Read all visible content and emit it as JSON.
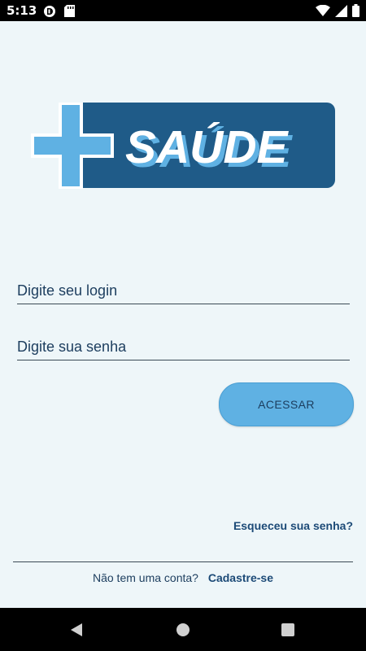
{
  "status_bar": {
    "time": "5:13",
    "icons": [
      "notification-icon",
      "sd-card-icon",
      "wifi-icon",
      "signal-icon",
      "battery-icon"
    ]
  },
  "logo": {
    "text": "SAÚDE",
    "colors": {
      "plus": "#5fb1e3",
      "banner": "#1f5b88",
      "text": "#ffffff"
    }
  },
  "form": {
    "login_placeholder": "Digite seu login",
    "password_placeholder": "Digite sua senha",
    "access_label": "ACESSAR"
  },
  "links": {
    "forgot_password": "Esqueceu sua senha?",
    "no_account": "Não tem uma conta?",
    "sign_up": "Cadastre-se"
  },
  "nav_bar": {
    "buttons": [
      "back-icon",
      "home-icon",
      "recents-icon"
    ]
  },
  "colors": {
    "background": "#eef6f9",
    "accent": "#5fb1e3",
    "text_dark": "#1c3d5e"
  }
}
